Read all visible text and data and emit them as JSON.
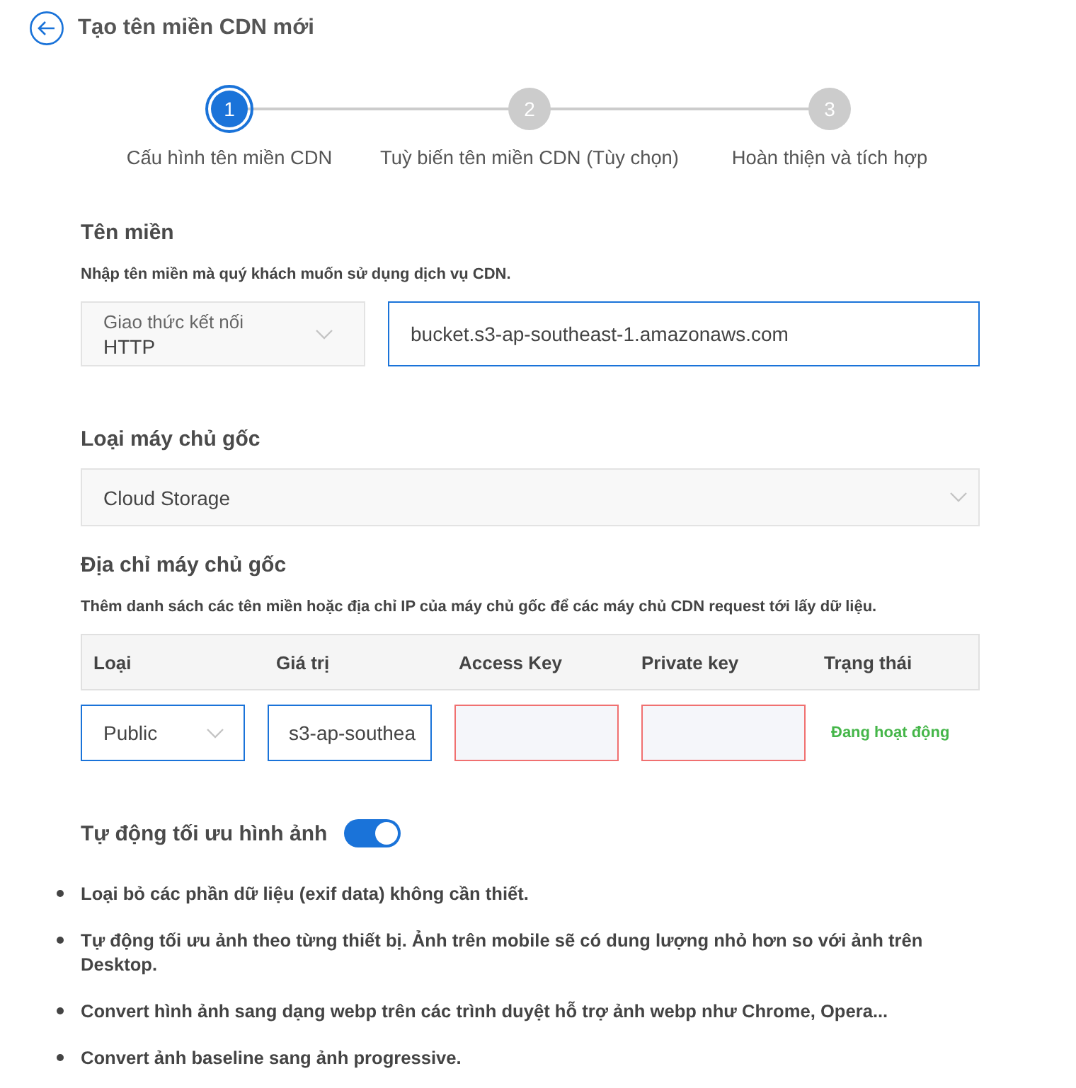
{
  "header": {
    "title": "Tạo tên miền CDN mới"
  },
  "steps": [
    {
      "number": "1",
      "label": "Cấu hình tên miền CDN",
      "selected": true
    },
    {
      "number": "2",
      "label": "Tuỳ biến tên miền CDN (Tùy chọn)",
      "selected": false
    },
    {
      "number": "3",
      "label": "Hoàn thiện và tích hợp",
      "selected": false
    }
  ],
  "domain_section": {
    "heading": "Tên miền",
    "description": "Nhập tên miền mà quý khách muốn sử dụng dịch vụ CDN.",
    "protocol_select": {
      "label": "Giao thức kết nối",
      "value": "HTTP",
      "disabled": true
    },
    "domain_input": {
      "value": "bucket.s3-ap-southeast-1.amazonaws.com",
      "invalid": false
    }
  },
  "origin_type_section": {
    "heading": "Loại máy chủ gốc",
    "select": {
      "value": "Cloud Storage",
      "disabled": true
    }
  },
  "origin_address_section": {
    "heading": "Địa chỉ máy chủ gốc",
    "description": "Thêm danh sách các tên miền hoặc địa chỉ IP của máy chủ gốc để các máy chủ CDN request tới lấy dữ liệu.",
    "table": {
      "columns": [
        "Loại",
        "Giá trị",
        "Access Key",
        "Private key",
        "Trạng thái"
      ],
      "rows": [
        {
          "cells": [
            {
              "kind": "select",
              "value": "Public",
              "disabled": false
            },
            {
              "kind": "input",
              "value": "s3-ap-southea",
              "invalid": false
            },
            {
              "kind": "input",
              "invalid": true
            },
            {
              "kind": "input",
              "invalid": true
            },
            {
              "kind": "status",
              "text": "Đang hoạt động"
            }
          ]
        }
      ]
    }
  },
  "image_optimization": {
    "label": "Tự động tối ưu hình ảnh",
    "on": true,
    "features": [
      "Loại bỏ các phần dữ liệu (exif data) không cần thiết.",
      "Tự động tối ưu ảnh theo từng thiết bị. Ảnh trên mobile sẽ có dung lượng nhỏ hơn so với ảnh trên Desktop.",
      "Convert hình ảnh sang dạng webp trên các trình duyệt hỗ trợ ảnh webp như Chrome, Opera...",
      "Convert ảnh baseline sang ảnh progressive."
    ]
  }
}
